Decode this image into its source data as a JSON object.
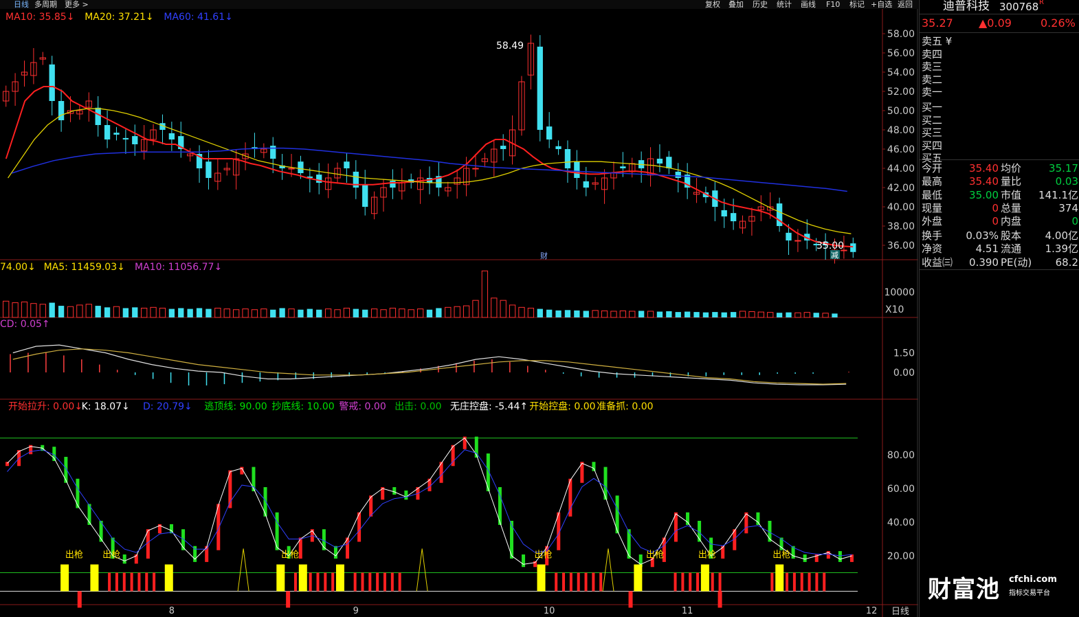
{
  "toolbar": {
    "period": "日线",
    "multi": "多周期",
    "more": "更多 >",
    "buttons": [
      "复权",
      "叠加",
      "历史",
      "统计",
      "画线",
      "F10",
      "标记",
      "+自选",
      "返回"
    ]
  },
  "stock": {
    "name": "迪普科技",
    "code": "300768",
    "flag": "R",
    "price": "35.27",
    "change": "▲0.09",
    "pct": "0.26%"
  },
  "orderbook": {
    "sell": [
      "卖五 ¥",
      "卖四",
      "卖三",
      "卖二",
      "卖一"
    ],
    "buy": [
      "买一",
      "买二",
      "买三",
      "买四",
      "买五"
    ]
  },
  "quote": [
    {
      "l1": "今开",
      "v1": "35.40",
      "c1": "red",
      "l2": "均价",
      "v2": "35.17",
      "c2": "grn"
    },
    {
      "l1": "最高",
      "v1": "35.40",
      "c1": "red",
      "l2": "量比",
      "v2": "0.03",
      "c2": "grn"
    },
    {
      "l1": "最低",
      "v1": "35.00",
      "c1": "grn",
      "l2": "市值",
      "v2": "141.1亿",
      "c2": "wht"
    },
    {
      "l1": "现量",
      "v1": "0",
      "c1": "red",
      "l2": "总量",
      "v2": "374",
      "c2": "wht"
    },
    {
      "l1": "外盘",
      "v1": "0",
      "c1": "red",
      "l2": "内盘",
      "v2": "0",
      "c2": "grn"
    },
    {
      "l1": "换手",
      "v1": "0.03%",
      "c1": "wht",
      "l2": "股本",
      "v2": "4.00亿",
      "c2": "wht"
    },
    {
      "l1": "净资",
      "v1": "4.51",
      "c1": "wht",
      "l2": "流通",
      "v2": "1.39亿",
      "c2": "wht"
    },
    {
      "l1": "收益㈢",
      "v1": "0.390",
      "c1": "wht",
      "l2": "PE(动)",
      "v2": "68.2",
      "c2": "wht"
    }
  ],
  "legends": {
    "price": [
      {
        "text": "MA10: 35.85↓",
        "color": "#ff3030"
      },
      {
        "text": "MA20: 37.21↓",
        "color": "#ffe000"
      },
      {
        "text": "MA60: 41.61↓",
        "color": "#3040ff"
      }
    ],
    "volume": [
      {
        "text": "74.00↓",
        "color": "#ffe000"
      },
      {
        "text": "MA5: 11459.03↓",
        "color": "#ffe000"
      },
      {
        "text": "MA10: 11056.77↓",
        "color": "#d040d0"
      }
    ],
    "macd": [
      {
        "text": "CD: 0.05↑",
        "color": "#d040d0"
      }
    ],
    "kdj": [
      {
        "text": "开始拉升: 0.00↓",
        "color": "#ff3030"
      },
      {
        "text": "K: 18.07↓",
        "color": "#ffffff"
      },
      {
        "text": "D: 20.79↓",
        "color": "#3040ff"
      },
      {
        "text": "逃顶线: 90.00",
        "color": "#00e000"
      },
      {
        "text": "抄底线: 10.00",
        "color": "#00e000"
      },
      {
        "text": "警戒: 0.00",
        "color": "#d040d0"
      },
      {
        "text": "出击: 0.00",
        "color": "#00c000"
      },
      {
        "text": "无庄控盘: -5.44↑",
        "color": "#ffffff"
      },
      {
        "text": "开始控盘: 0.00",
        "color": "#ffe000"
      },
      {
        "text": "准备抓: 0.00",
        "color": "#ffe000"
      }
    ]
  },
  "signal_label": "出枪",
  "markers": {
    "cai": "财",
    "jian": "减"
  },
  "period_label": "日线",
  "logo": {
    "big": "财富池",
    "domain": "cfchi.com",
    "sub": "指标交易平台"
  },
  "chart_data": {
    "type": "candlestick",
    "xlabel_ticks": [
      {
        "label": "8",
        "index": 18
      },
      {
        "label": "9",
        "index": 38
      },
      {
        "label": "10",
        "index": 59
      },
      {
        "label": "11",
        "index": 74
      },
      {
        "label": "12",
        "index": 94
      }
    ],
    "price_axis": {
      "ticks": [
        "58.00",
        "56.00",
        "54.00",
        "52.00",
        "50.00",
        "48.00",
        "46.00",
        "44.00",
        "42.00",
        "40.00",
        "38.00",
        "36.00"
      ],
      "ylim": [
        34.5,
        59.5
      ]
    },
    "price_annotations": {
      "high": "58.49",
      "last": "35.00"
    },
    "volume_axis": {
      "ticks": [
        "10000"
      ],
      "unit": "X10"
    },
    "macd_axis": {
      "ticks": [
        "1.50",
        "0.00"
      ]
    },
    "kdj_axis": {
      "ticks": [
        "80.00",
        "60.00",
        "40.00",
        "20.00"
      ],
      "lines": [
        90,
        10
      ]
    },
    "close": [
      52,
      53,
      54,
      55,
      55.5,
      51,
      49,
      50,
      50,
      51,
      48.5,
      47,
      47.5,
      47,
      46.5,
      47,
      48,
      48,
      47,
      46,
      45.5,
      44,
      43,
      43.5,
      44,
      45,
      45.5,
      46,
      46,
      45,
      44,
      44,
      43.5,
      43,
      42.5,
      43,
      44,
      44,
      42,
      40,
      41,
      42,
      42,
      42.5,
      42.5,
      43,
      42.5,
      42,
      42,
      43,
      44,
      44,
      45,
      46,
      46,
      48,
      53,
      57,
      48,
      47,
      46,
      44,
      43,
      42,
      42.5,
      43,
      43.5,
      44,
      44.5,
      44,
      45,
      44.5,
      44,
      43,
      42,
      41.5,
      41,
      40,
      39,
      38.5,
      38.5,
      39,
      40,
      40,
      38,
      36.5,
      36.5,
      36.5,
      36,
      36,
      35.5,
      35.5,
      35.3
    ],
    "ma10": [
      45,
      48,
      51,
      52,
      52.5,
      52.5,
      52,
      51,
      50.5,
      50,
      49.5,
      49,
      48.5,
      48,
      47.5,
      47,
      46.8,
      46.5,
      46.5,
      46,
      45.5,
      45,
      45,
      45,
      45,
      44.8,
      44.5,
      44.3,
      44,
      43.7,
      43.5,
      43.3,
      43,
      42.8,
      42.6,
      42.5,
      42.4,
      42.3,
      42.3,
      42.3,
      42.4,
      42.5,
      42.5,
      42.6,
      42.7,
      42.8,
      43,
      43.3,
      43.8,
      44.5,
      45.5,
      46.5,
      47,
      47,
      46.5,
      46,
      45.2,
      44.5,
      44,
      43.8,
      43.6,
      43.5,
      43.4,
      43.4,
      43.5,
      43.6,
      43.7,
      43.7,
      43.6,
      43.4,
      43.1,
      42.8,
      42.5,
      42,
      41.5,
      41,
      40.5,
      40.2,
      40,
      39.8,
      39.6,
      39.3,
      38.7,
      38,
      37.3,
      36.8,
      36.4,
      36.2,
      36,
      35.9,
      35.85
    ],
    "ma20": [
      43,
      45,
      47,
      48.5,
      49.5,
      50,
      50.2,
      50.2,
      50,
      49.7,
      49.3,
      48.8,
      48.3,
      47.8,
      47.3,
      46.8,
      46.3,
      45.8,
      45.3,
      44.8,
      44.5,
      44.2,
      44,
      43.8,
      43.6,
      43.4,
      43.2,
      43,
      42.9,
      42.8,
      42.7,
      42.6,
      42.5,
      42.5,
      42.5,
      42.6,
      42.8,
      43.1,
      43.5,
      44,
      44.3,
      44.5,
      44.6,
      44.7,
      44.7,
      44.7,
      44.6,
      44.5,
      44.4,
      44.3,
      44.1,
      43.8,
      43.4,
      43,
      42.5,
      41.9,
      41.2,
      40.5,
      39.8,
      39.2,
      38.6,
      38.1,
      37.7,
      37.4,
      37.2
    ],
    "ma60": [
      43.5,
      44.2,
      44.8,
      45.2,
      45.5,
      45.6,
      45.7,
      45.7,
      45.7,
      45.7,
      45.8,
      46,
      46.1,
      46.1,
      46,
      45.8,
      45.6,
      45.4,
      45.2,
      45,
      44.8,
      44.5,
      44.3,
      44.1,
      44,
      43.9,
      43.8,
      43.7,
      43.6,
      43.5,
      43.4,
      43.3,
      43.2,
      43.1,
      42.9,
      42.7,
      42.5,
      42.3,
      42.1,
      41.9,
      41.61
    ],
    "volume": [
      2100,
      1900,
      2000,
      1800,
      1700,
      1900,
      1500,
      1400,
      1600,
      1700,
      1500,
      1300,
      1400,
      1200,
      1300,
      1200,
      1300,
      1200,
      1100,
      1200,
      1100,
      1200,
      1100,
      1200,
      1100,
      1000,
      1100,
      1000,
      1100,
      1000,
      1200,
      1100,
      1000,
      1100,
      1000,
      1100,
      1000,
      1200,
      1100,
      1000,
      1100,
      1000,
      1200,
      1100,
      1000,
      1100,
      1000,
      1200,
      1300,
      1400,
      1500,
      2200,
      6000,
      2500,
      2200,
      1600,
      1300,
      1200,
      1100,
      1000,
      900,
      950,
      900,
      850,
      900,
      850,
      800,
      850,
      800,
      850,
      800,
      750,
      800,
      700,
      750,
      700,
      650,
      700,
      650,
      700,
      800,
      750,
      700,
      650,
      600,
      650,
      600,
      650,
      600,
      550,
      500
    ],
    "kdj_k": [
      75,
      82,
      85,
      84,
      78,
      65,
      50,
      40,
      30,
      20,
      17,
      20,
      35,
      38,
      35,
      25,
      18,
      25,
      50,
      70,
      72,
      60,
      45,
      25,
      20,
      30,
      35,
      25,
      20,
      30,
      45,
      55,
      60,
      58,
      55,
      60,
      65,
      75,
      85,
      90,
      80,
      60,
      40,
      20,
      15,
      16,
      25,
      45,
      65,
      75,
      72,
      55,
      35,
      20,
      15,
      18,
      30,
      45,
      40,
      30,
      20,
      25,
      35,
      45,
      40,
      30,
      25,
      20,
      18,
      20,
      22,
      18,
      20
    ],
    "kdj_d": [
      70,
      78,
      82,
      83,
      80,
      72,
      60,
      50,
      40,
      30,
      24,
      22,
      28,
      33,
      34,
      30,
      24,
      24,
      36,
      52,
      62,
      61,
      53,
      40,
      30,
      30,
      32,
      29,
      25,
      27,
      35,
      44,
      51,
      54,
      55,
      57,
      61,
      68,
      76,
      83,
      81,
      71,
      56,
      38,
      27,
      22,
      23,
      33,
      48,
      61,
      66,
      61,
      48,
      34,
      25,
      22,
      26,
      35,
      38,
      34,
      27,
      26,
      30,
      37,
      38,
      34,
      30,
      25,
      22,
      21,
      21,
      20,
      20.79
    ],
    "macd_hist": [
      1.4,
      1.5,
      1.5,
      1.3,
      1.0,
      0.6,
      0.2,
      -0.2,
      -0.5,
      -0.8,
      -1.0,
      -1.0,
      -0.9,
      -0.8,
      -0.7,
      -0.6,
      -0.5,
      -0.5,
      -0.4,
      -0.3,
      -0.2,
      -0.1,
      0.1,
      0.3,
      0.5,
      0.7,
      0.9,
      1.0,
      0.8,
      0.5,
      0.2,
      -0.1,
      -0.3,
      -0.4,
      -0.4,
      -0.4,
      -0.3,
      -0.3,
      -0.3,
      -0.3,
      -0.2,
      -0.2,
      -0.2,
      -0.1,
      -0.1,
      -0.1,
      0.0,
      0.05
    ],
    "macd_dif": [
      1.5,
      2.0,
      2.1,
      1.8,
      1.5,
      1.0,
      0.6,
      0.3,
      0.1,
      0.0,
      -0.3,
      -0.5,
      -0.5,
      -0.4,
      -0.3,
      -0.2,
      -0.1,
      0.1,
      0.3,
      0.6,
      1.0,
      1.2,
      1.0,
      0.7,
      0.4,
      0.1,
      -0.1,
      -0.2,
      -0.3,
      -0.4,
      -0.5,
      -0.6,
      -0.8,
      -0.9,
      -0.95,
      -0.95,
      -0.9
    ],
    "macd_dea": [
      1.0,
      1.4,
      1.7,
      1.8,
      1.7,
      1.5,
      1.2,
      0.9,
      0.6,
      0.4,
      0.2,
      0.0,
      -0.1,
      -0.2,
      -0.2,
      -0.2,
      -0.1,
      0.0,
      0.2,
      0.4,
      0.6,
      0.8,
      0.9,
      0.9,
      0.8,
      0.6,
      0.4,
      0.2,
      0.0,
      -0.2,
      -0.4,
      -0.5,
      -0.7,
      -0.8,
      -0.85,
      -0.9,
      -0.85
    ]
  }
}
